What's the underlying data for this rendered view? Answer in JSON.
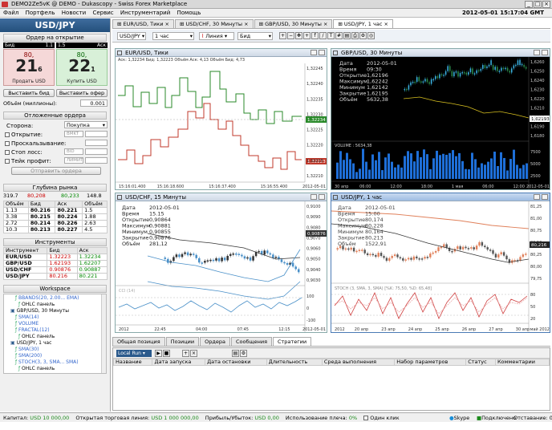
{
  "window": {
    "title": "DEMO2Ze5vK @ DEMO - Dukascopy - Swiss Forex Marketplace"
  },
  "menu": {
    "items": [
      "Файл",
      "Портфель",
      "Новости",
      "Сервис",
      "Инструментарий",
      "Помощь"
    ],
    "clock": "2012-05-01 15:17:04 GMT"
  },
  "instrument": {
    "title": "USD/JPY"
  },
  "order_entry": {
    "header": "Ордер на открытие",
    "bid_label": "Бид",
    "bid_amount": "1.1",
    "ask_label": "Аск",
    "ask_amount": "1.5",
    "sell_big_prefix": "80,",
    "sell_big": "21",
    "sell_small": "6",
    "sell_label": "Продать USD",
    "buy_big_prefix": "80,",
    "buy_big": "22",
    "buy_small": "1",
    "buy_label": "Купить USD",
    "place_bid": "Выставить бид",
    "place_offer": "Выставить офер",
    "volume_label": "Объём (миллионы):",
    "volume_value": "0.001"
  },
  "pending": {
    "header": "Отложенные ордера",
    "side_label": "Сторона:",
    "side_value": "Покупка",
    "open_label": "Открытие:",
    "open_value": "BMKT",
    "slippage_label": "Проскальзывание:",
    "stop_label": "Стоп лосс:",
    "stop_value": "BID",
    "take_label": "Тейк профит:",
    "take_value": "ЛИМИТ",
    "submit": "Отправить ордера"
  },
  "depth": {
    "header": "Глубина рынка",
    "summary_left": "319.7",
    "summary_bid": "80,208",
    "summary_ask": "80,233",
    "summary_right": "148.8",
    "columns": [
      "Объём",
      "Бид",
      "Аск",
      "Объём"
    ],
    "rows": [
      [
        "1.13",
        "80.216",
        "80.221",
        "1.5"
      ],
      [
        "3.38",
        "80.215",
        "80.224",
        "1.88"
      ],
      [
        "2.72",
        "80.214",
        "80.226",
        "2.63"
      ],
      [
        "10.3",
        "80.213",
        "80.227",
        "4.5"
      ]
    ]
  },
  "instruments": {
    "header": "Инструменты",
    "columns": [
      "Инструмент",
      "Бид",
      "Аск"
    ],
    "rows": [
      [
        "EUR/USD",
        "1.32223",
        "1.32234"
      ],
      [
        "GBP/USD",
        "1.62193",
        "1.62207"
      ],
      [
        "USD/CHF",
        "0.90876",
        "0.90887"
      ],
      [
        "USD/JPY",
        "80.216",
        "80.221"
      ]
    ]
  },
  "workspace": {
    "header": "Workspace",
    "items": [
      "BBANDS(20, 2.00... EMA)",
      "OHLC панель",
      "GBP/USD, 30 Минуты",
      "SMA(14)",
      "VOLUME",
      "FRACTAL(12)",
      "OHLC панель",
      "USD/JPY, 1 час",
      "SMA(30)",
      "SMA(200)",
      "STOCH(3, 3, SMA... SMA)",
      "OHLC панель"
    ]
  },
  "tabs": [
    "EUR/USD, Тики",
    "USD/CHF, 30 Минуты",
    "GBP/USD, 30 Минуты",
    "USD/JPY, 1 час"
  ],
  "toolbar": {
    "instrument": "USD/JPY",
    "period": "1 час",
    "line": "Линия",
    "price": "Бид"
  },
  "charts": {
    "eurusd": {
      "title": "EUR/USD, Тики",
      "info": "Аск: 1,32234 Бид: 1,32223 Объём Аск: 4,13 Объём Бид: 4,73",
      "yticks": [
        "1,32245",
        "1,32240",
        "1,32235",
        "1,32230",
        "1,32225",
        "1,32220",
        "1,32215",
        "1,32210"
      ],
      "xticks": [
        "15:16:01.400",
        "15:16:18.600",
        "15:16:37.400",
        "15:16:55.400",
        "2012-05-01"
      ],
      "ask_label": "1,32234",
      "bid_label": "1,32223"
    },
    "gbpusd": {
      "title": "GBP/USD, 30 Минуты",
      "ohlc": [
        [
          "Дата",
          "2012-05-01"
        ],
        [
          "Время",
          "09:30"
        ],
        [
          "Открытие",
          "1,62196"
        ],
        [
          "Максимум",
          "1,62242"
        ],
        [
          "Минимум",
          "1,62142"
        ],
        [
          "Закрытие",
          "1,62195"
        ],
        [
          "Объём",
          "5632,38"
        ]
      ],
      "yticks": [
        "1,6260",
        "1,6250",
        "1,6240",
        "1,6230",
        "1,6220",
        "1,6210",
        "1,6200",
        "1,6190",
        "1,6180"
      ],
      "volume_label": "VOLUME : 5634,38",
      "vol_ticks": [
        "7500",
        "5000",
        "2500"
      ],
      "xticks": [
        "30 апр",
        "06:00",
        "12:00",
        "18:00",
        "1 мая",
        "06:00",
        "12:00",
        "2012-05-01"
      ],
      "price_label": "1,62193"
    },
    "usdchf": {
      "title": "USD/CHF, 15 Минуты",
      "ohlc": [
        [
          "Дата",
          "2012-05-01"
        ],
        [
          "Время",
          "15.15"
        ],
        [
          "Открытие",
          "0,90864"
        ],
        [
          "Максимум",
          "0,90881"
        ],
        [
          "Минимум",
          "0,90855"
        ],
        [
          "Закрытие",
          "0,90876"
        ],
        [
          "Объём",
          "281,12"
        ]
      ],
      "yticks": [
        "0,9100",
        "0,9090",
        "0,9080",
        "0,9070",
        "0,9060",
        "0,9050",
        "0,9040",
        "0,9030"
      ],
      "cci_label": "CCI (14)",
      "cci_ticks": [
        "100",
        "0",
        "-100"
      ],
      "xticks": [
        "2012",
        "22:45",
        "04:00",
        "07:45",
        "12:15",
        "2012-05-01"
      ],
      "price_label": "0,90876"
    },
    "usdjpy": {
      "title": "USD/JPY, 1 час",
      "ohlc": [
        [
          "Дата",
          "2012-05-01"
        ],
        [
          "Время",
          "15:00"
        ],
        [
          "Открытие",
          "80,174"
        ],
        [
          "Максимум",
          "80,228"
        ],
        [
          "Минимум",
          "80,164"
        ],
        [
          "Закрытие",
          "80,213"
        ],
        [
          "Объём",
          "1522,91"
        ]
      ],
      "yticks": [
        "81,25",
        "81,00",
        "80,75",
        "80,50",
        "80,25",
        "80,00",
        "79,75"
      ],
      "stoch_label": "STOCH (3, SMA, 3, SMA) [%K: 75,50, %D: 65,48]",
      "stoch_ticks": [
        "80",
        "50",
        "20"
      ],
      "xticks": [
        "2012",
        "20 апр",
        "23 апр",
        "24 апр",
        "25 апр",
        "26 апр",
        "27 апр",
        "30 апр",
        "май 2012"
      ],
      "price_label": "80,216"
    }
  },
  "bottom": {
    "tabs": [
      "Общая позиция",
      "Позиции",
      "Ордера",
      "Сообщения",
      "Стратегии"
    ],
    "active_tab": "Стратегии",
    "dropdown": "Local Run",
    "columns": [
      "Название",
      "Дата запуска",
      "Дата остановки",
      "Длительность",
      "Среда выполнения",
      "Набор параметров",
      "Статус",
      "Комментарии"
    ]
  },
  "status": {
    "capital_label": "Капитал:",
    "capital": "USD 10 000,00",
    "margin_label": "Открытая торговая линия:",
    "margin": "USD 1 000 000,00",
    "pnl_label": "Прибыль/Убыток:",
    "pnl": "USD 0,00",
    "leverage_label": "Использование плеча:",
    "leverage": "0%",
    "oneclick": "Один клик",
    "skype": "Skype",
    "connected": "Подключено",
    "lag": "Отставание: 0"
  },
  "colors": {
    "sell": "#f5d8d8",
    "buy": "#d8f0d8",
    "accent": "#2b5a8c",
    "green": "#1c8a1c",
    "red": "#c83c3c"
  }
}
